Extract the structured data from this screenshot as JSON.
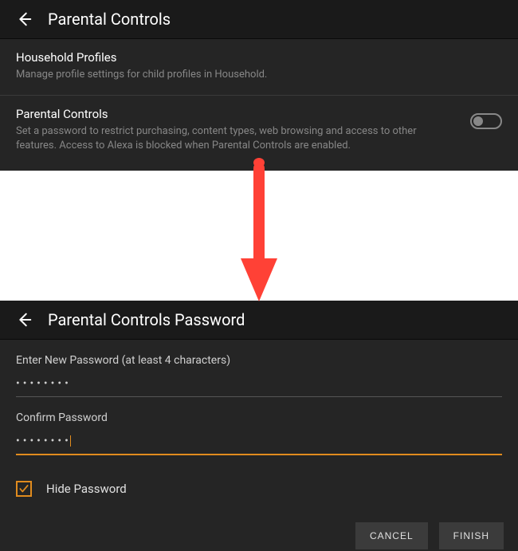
{
  "top": {
    "title": "Parental Controls",
    "household": {
      "title": "Household Profiles",
      "desc": "Manage profile settings for child profiles in Household."
    },
    "parental": {
      "title": "Parental Controls",
      "desc": "Set a password to restrict purchasing, content types, web browsing and access to other features. Access to Alexa is blocked when Parental Controls are enabled.",
      "toggle_state": "off"
    }
  },
  "bottom": {
    "title": "Parental Controls Password",
    "enter_label": "Enter New Password (at least 4 characters)",
    "enter_value": "••••••••",
    "confirm_label": "Confirm Password",
    "confirm_value": "••••••••",
    "hide_label": "Hide Password",
    "hide_checked": true,
    "cancel": "CANCEL",
    "finish": "FINISH"
  },
  "colors": {
    "accent": "#e08b1e",
    "arrow": "#ff4136"
  }
}
